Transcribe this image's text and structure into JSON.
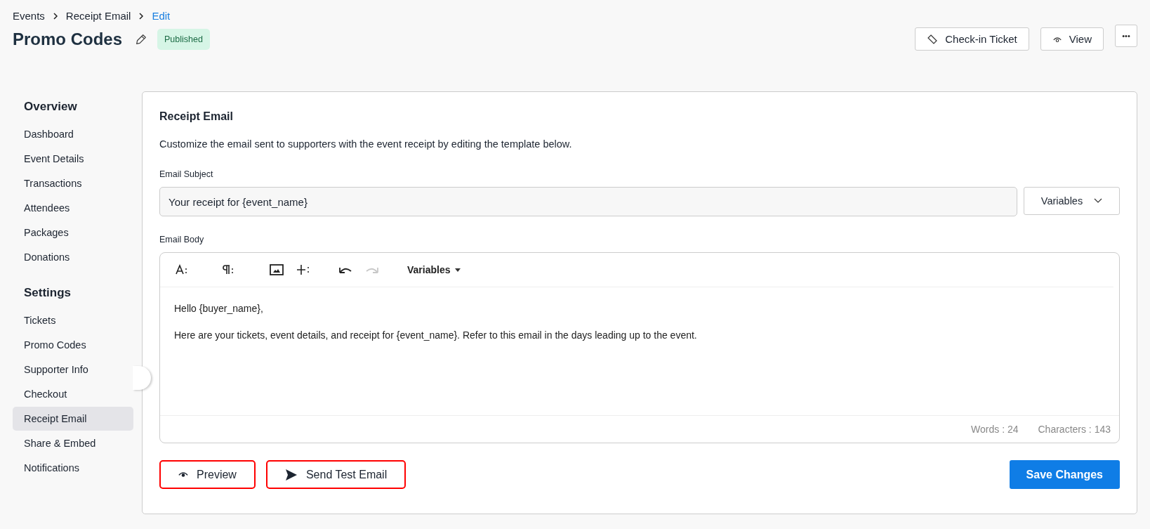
{
  "breadcrumb": [
    {
      "label": "Events",
      "current": false
    },
    {
      "label": "Receipt Email",
      "current": false
    },
    {
      "label": "Edit",
      "current": true
    }
  ],
  "header": {
    "title": "Promo Codes",
    "status": "Published",
    "actions": [
      {
        "kind": "ticket",
        "label": "Check-in Ticket"
      },
      {
        "kind": "view",
        "label": "View"
      }
    ],
    "more": "•••"
  },
  "sidebar": [
    {
      "title": "Overview",
      "items": [
        {
          "label": "Dashboard",
          "selected": false
        },
        {
          "label": "Event Details",
          "selected": false
        },
        {
          "label": "Transactions",
          "selected": false
        },
        {
          "label": "Attendees",
          "selected": false
        },
        {
          "label": "Packages",
          "selected": false
        },
        {
          "label": "Donations",
          "selected": false
        }
      ]
    },
    {
      "title": "Settings",
      "items": [
        {
          "label": "Tickets",
          "selected": false
        },
        {
          "label": "Promo Codes",
          "selected": false
        },
        {
          "label": "Supporter Info",
          "selected": false
        },
        {
          "label": "Checkout",
          "selected": false
        },
        {
          "label": "Receipt Email",
          "selected": true
        },
        {
          "label": "Share & Embed",
          "selected": false
        },
        {
          "label": "Notifications",
          "selected": false
        }
      ]
    }
  ],
  "card": {
    "title": "Receipt Email",
    "description": "Customize the email sent to supporters with the event receipt by editing the template below.",
    "subject": {
      "label": "Email Subject",
      "value": "Your receipt for {event_name}",
      "variables": "Variables"
    },
    "body": {
      "label": "Email Body",
      "tools": [
        {
          "kind": "text",
          "disabled": false
        },
        {
          "kind": "paragraph",
          "disabled": false
        },
        {
          "kind": "image",
          "disabled": false
        },
        {
          "kind": "insert",
          "disabled": false
        },
        {
          "kind": "undo",
          "disabled": false
        },
        {
          "kind": "redo",
          "disabled": true
        }
      ],
      "variables": "Variables",
      "paragraphs": [
        "Hello {buyer_name},",
        "Here are your tickets, event details, and receipt for {event_name}. Refer to this email in the days leading up to the event."
      ],
      "words": "Words : 24",
      "characters": "Characters : 143"
    },
    "buttons": [
      {
        "kind": "preview",
        "label": "Preview"
      },
      {
        "kind": "send",
        "label": "Send Test Email"
      },
      {
        "kind": "save",
        "label": "Save Changes"
      }
    ]
  }
}
